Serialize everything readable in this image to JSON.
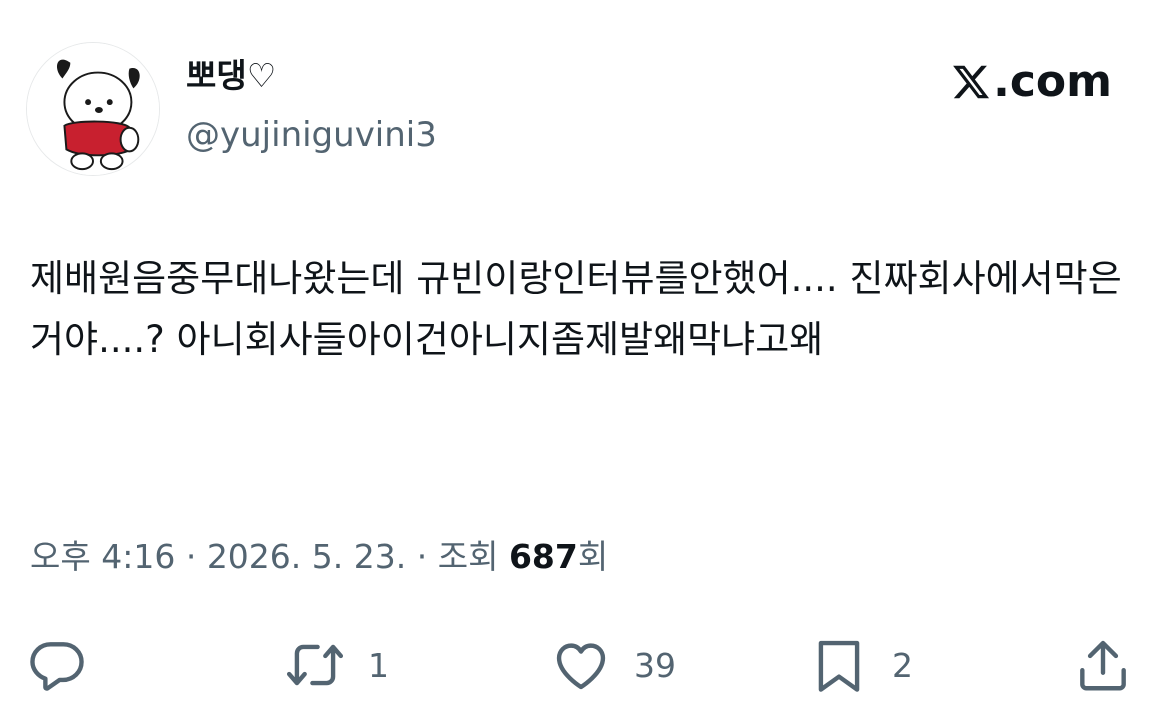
{
  "author": {
    "display_name": "뽀댕♡",
    "handle": "@yujiniguvini3",
    "avatar": "pochacco-avatar"
  },
  "brand": {
    "label": ".com",
    "logo": "x-logo-icon"
  },
  "tweet": {
    "text": "제배원음중무대나왔는데 규빈이랑인터뷰를안했어.... 진짜회사에서막은거야....? 아니회사들아이건아니지좀제발왜막냐고왜"
  },
  "meta": {
    "time": "오후 4:16",
    "sep1": " · ",
    "date": "2026. 5. 23.",
    "sep2": " · ",
    "views_label": "조회 ",
    "views_count": "687",
    "views_suffix": "회"
  },
  "actions": {
    "reply": {
      "icon": "reply-icon",
      "count": ""
    },
    "retweet": {
      "icon": "retweet-icon",
      "count": "1"
    },
    "like": {
      "icon": "heart-icon",
      "count": "39"
    },
    "bookmark": {
      "icon": "bookmark-icon",
      "count": "2"
    },
    "share": {
      "icon": "share-icon",
      "count": ""
    }
  },
  "colors": {
    "text": "#0f1419",
    "secondary": "#536471",
    "avatar_shirt": "#c8202f"
  }
}
